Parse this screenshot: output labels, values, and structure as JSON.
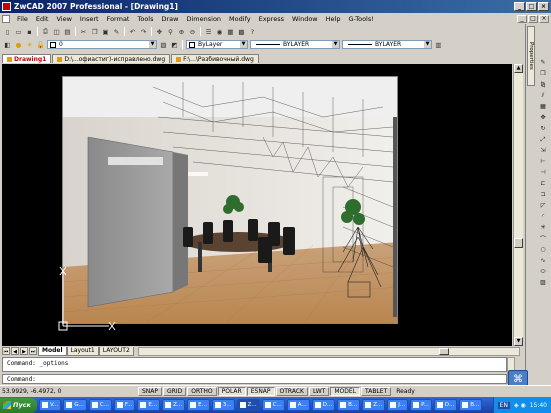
{
  "window": {
    "title": "ZwCAD 2007 Professional - [Drawing1]",
    "buttons": [
      "_",
      "□",
      "×"
    ]
  },
  "menu": {
    "items": [
      "File",
      "Edit",
      "View",
      "Insert",
      "Format",
      "Tools",
      "Draw",
      "Dimension",
      "Modify",
      "Express",
      "Window",
      "Help",
      "G-Tools!"
    ],
    "mdi_buttons": [
      "_",
      "□",
      "×"
    ]
  },
  "toolbar": {
    "layer_value": "0",
    "color_value": "ByLayer",
    "linetype_value": "BYLAYER",
    "lineweight_value": "BYLAYER"
  },
  "doc_tabs": [
    {
      "label": "Drawing1",
      "active": true
    },
    {
      "label": "D:\\...офиастиг)-исправлено.dwg",
      "active": false
    },
    {
      "label": "F:\\...\\Разбивочный.dwg",
      "active": false
    }
  ],
  "properties_panel": {
    "label": "Properties"
  },
  "layout_tabs": [
    {
      "label": "Model",
      "active": true
    },
    {
      "label": "Layout1",
      "active": false
    },
    {
      "label": "LAYOUT2",
      "active": false
    }
  ],
  "command": {
    "history": "Command: _options",
    "prompt": "Command:"
  },
  "status": {
    "coordinates": "53.9929, -6.4972, 0",
    "toggles": [
      {
        "label": "SNAP",
        "on": false
      },
      {
        "label": "GRID",
        "on": false
      },
      {
        "label": "ORTHO",
        "on": false
      },
      {
        "label": "POLAR",
        "on": true
      },
      {
        "label": "ESNAP",
        "on": true
      },
      {
        "label": "OTRACK",
        "on": false
      },
      {
        "label": "LWT",
        "on": false
      },
      {
        "label": "MODEL",
        "on": true
      },
      {
        "label": "TABLET",
        "on": false
      }
    ],
    "state_text": "Ready"
  },
  "taskbar": {
    "start_label": "Пуск",
    "items": [
      "V...",
      "G...",
      "C...",
      "F...",
      "E...",
      "Z...",
      "E...",
      "3...",
      "Z...",
      "C...",
      "A...",
      "D...",
      "B...",
      "Z...",
      "J...",
      "P...",
      "D...",
      "B..."
    ],
    "lang": "EN",
    "clock": "15:40"
  },
  "colors": {
    "title_gradient_start": "#0a246a",
    "model_background": "#000000",
    "taskbar_blue": "#3168d5"
  }
}
